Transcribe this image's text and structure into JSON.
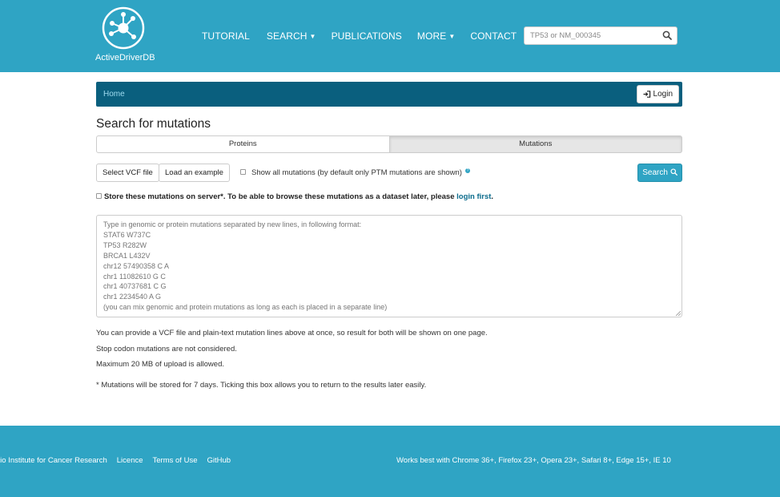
{
  "header": {
    "logo_text": "ActiveDriverDB",
    "nav": [
      {
        "label": "TUTORIAL",
        "dropdown": false
      },
      {
        "label": "SEARCH",
        "dropdown": true
      },
      {
        "label": "PUBLICATIONS",
        "dropdown": false
      },
      {
        "label": "MORE",
        "dropdown": true
      },
      {
        "label": "CONTACT",
        "dropdown": false
      }
    ],
    "search_placeholder": "TP53 or NM_000345"
  },
  "breadcrumb": {
    "home": "Home",
    "login_label": "Login"
  },
  "page": {
    "title": "Search for mutations",
    "tabs": [
      {
        "label": "Proteins",
        "active": true
      },
      {
        "label": "Mutations",
        "active": false
      }
    ],
    "select_vcf_label": "Select VCF file",
    "load_example_label": "Load an example",
    "show_all_label": "Show all mutations (by default only PTM mutations are shown)",
    "search_label": "Search",
    "store_text": "Store these mutations on server*. To be able to browse these mutations as a dataset later, please ",
    "store_link": "login first",
    "store_end": ".",
    "textarea_placeholder": "Type in genomic or protein mutations separated by new lines, in following format:\nSTAT6 W737C\nTP53 R282W\nBRCA1 L432V\nchr12 57490358 C A\nchr1 11082610 G C\nchr1 40737681 C G\nchr1 2234540 A G\n(you can mix genomic and protein mutations as long as each is placed in a separate line)",
    "notes": [
      "You can provide a VCF file and plain-text mutation lines above at once, so result for both will be shown on one page.",
      "Stop codon mutations are not considered.",
      "Maximum 20 MB of upload is allowed.",
      "* Mutations will be stored for 7 days. Ticking this box allows you to return to the results later easily."
    ]
  },
  "footer": {
    "links": [
      "rio Institute for Cancer Research",
      "Licence",
      "Terms of Use",
      "GitHub"
    ],
    "browser_note": "Works best with Chrome 36+, Firefox 23+, Opera 23+, Safari 8+, Edge 15+, IE 10"
  },
  "colors": {
    "primary": "#2fa4c4",
    "breadcrumb_bg": "#0a5f7e",
    "link": "#0a6b8c"
  },
  "icons": [
    "logo-network-icon",
    "search-icon",
    "login-icon",
    "info-icon",
    "caret-down-icon"
  ]
}
